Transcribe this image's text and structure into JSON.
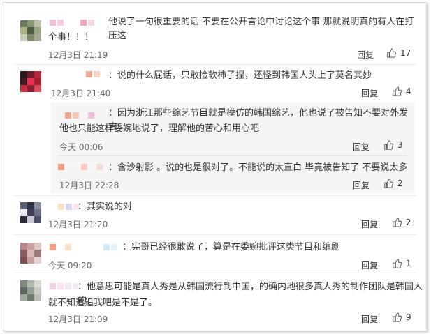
{
  "reply_label": "回复",
  "comments": [
    {
      "author_suffix": "",
      "text_line1": "他说了一句很重要的话  不要在公开言论中讨论这个事  那就说明真的有人在打压这",
      "text_line2": "个事！！！",
      "time": "12月3日 21:19",
      "likes": "17"
    },
    {
      "author_suffix": "：",
      "text_line1": "说的什么屁话，只敢捡软柿子捏，还怪到韩国人头上了莫名其妙",
      "time": "12月3日 21:40",
      "likes": "4"
    },
    {
      "author_suffix": "：",
      "text_line1": "因为浙江那些综艺节目就是模仿的韩国综艺，他也说了被告知不要对外发言，",
      "text_line2": "他也只能这样委婉地说了，理解他的苦心和用心吧",
      "time": "今天 00:06",
      "likes": "3"
    },
    {
      "author_suffix": "：",
      "text_line1": "含沙射影 。说的也是很对了。不能说的太直白 毕竟被告知了 不要说太多",
      "time": "12月3日 22:28",
      "likes": "2"
    },
    {
      "author_suffix": "：",
      "text_line1": "其实说的对",
      "time": "12月3日 21:20",
      "likes": "2"
    },
    {
      "author_suffix": "：",
      "text_line1": "宪哥已经很敢说了，算是在委婉批评这类节目和编剧",
      "time": "今天 09:20",
      "likes": "1"
    },
    {
      "author_suffix": "：",
      "text_line1": "他意思可能是真人秀是从韩国流行到中国，的确内地很多真人秀的制作团队是韩国人的。",
      "text_line2": "就不知道追我吧是不是了。",
      "time": "12月3日 21:09",
      "likes": "9"
    }
  ],
  "colors": {
    "text": "#333333",
    "meta": "#666666",
    "subbox": "#f5f5f5"
  }
}
